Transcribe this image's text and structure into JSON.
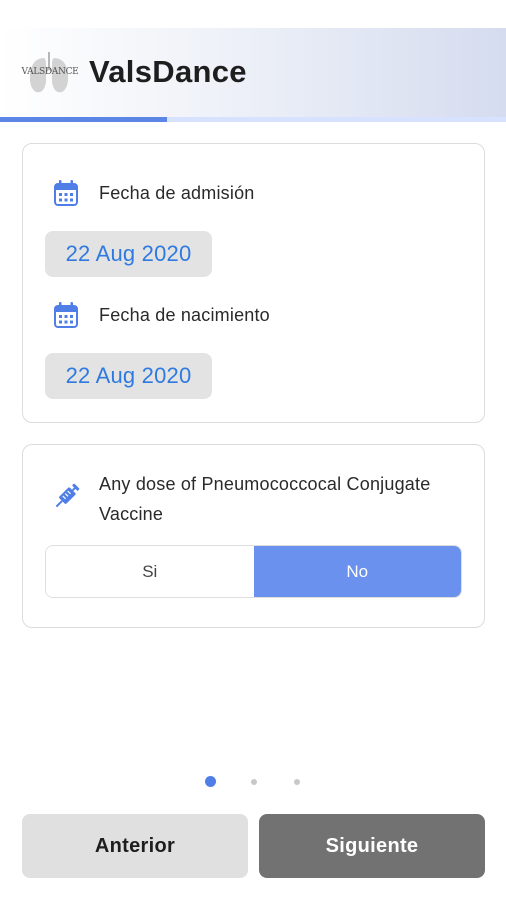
{
  "header": {
    "logo_text": "VALSDANCE",
    "title": "ValsDance",
    "progress": 0.33
  },
  "dates_card": {
    "admission": {
      "label": "Fecha de admisión",
      "value": "22 Aug 2020"
    },
    "birth": {
      "label": "Fecha de nacimiento",
      "value": "22 Aug 2020"
    }
  },
  "vaccine_card": {
    "question": "Any dose of Pneumococcocal Conjugate Vaccine",
    "options": [
      {
        "label": "Si",
        "selected": false
      },
      {
        "label": "No",
        "selected": true
      }
    ]
  },
  "pager": {
    "current": 1,
    "total": 3
  },
  "footer": {
    "prev_label": "Anterior",
    "next_label": "Siguiente"
  },
  "colors": {
    "accent": "#5b86e5",
    "date_text": "#2f7ae0",
    "selected_segment": "#6a91ee",
    "next_button": "#727272"
  }
}
